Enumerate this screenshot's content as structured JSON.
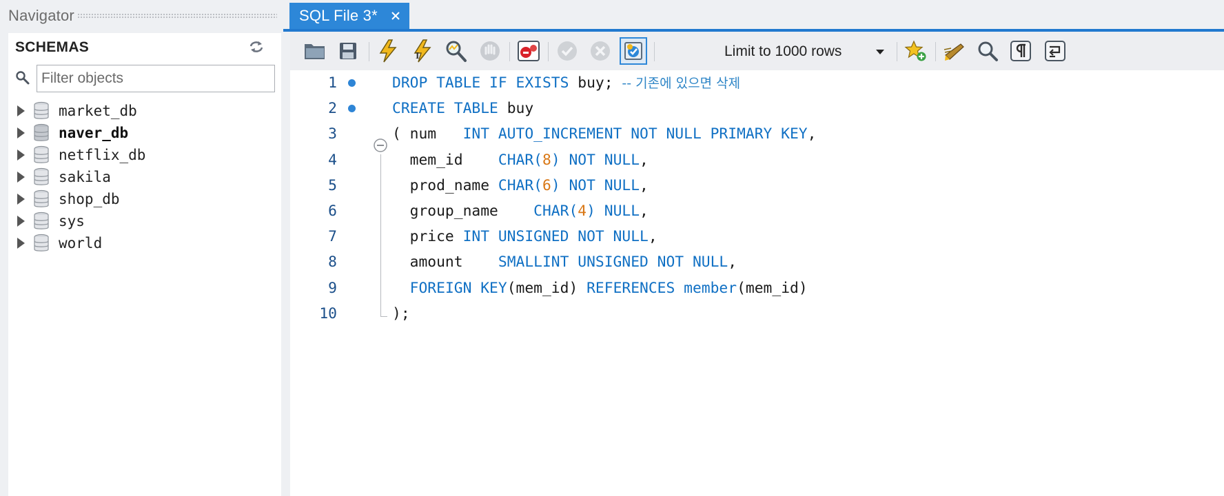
{
  "navigator": {
    "title": "Navigator",
    "schemas_label": "SCHEMAS",
    "filter_placeholder": "Filter objects",
    "schemas": [
      {
        "name": "market_db",
        "active": false
      },
      {
        "name": "naver_db",
        "active": true
      },
      {
        "name": "netflix_db",
        "active": false
      },
      {
        "name": "sakila",
        "active": false
      },
      {
        "name": "shop_db",
        "active": false
      },
      {
        "name": "sys",
        "active": false
      },
      {
        "name": "world",
        "active": false
      }
    ]
  },
  "editor": {
    "tab_label": "SQL File 3*",
    "toolbar": {
      "buttons": [
        "open-file-icon",
        "save-icon",
        "execute-icon",
        "execute-current-icon",
        "explain-icon",
        "stop-icon",
        "toggle-error-icon",
        "commit-icon",
        "rollback-icon",
        "autocommit-icon",
        "bookmark-icon",
        "beautify-icon",
        "find-icon",
        "invisible-chars-icon",
        "word-wrap-icon"
      ],
      "limit_value": "Limit to 1000 rows"
    },
    "code_lines": [
      {
        "n": "1",
        "dot": true,
        "html": "<span class=\"kw\">DROP TABLE IF EXISTS</span> buy; <span class=\"cm\">-- 기존에 있으면 삭제</span>"
      },
      {
        "n": "2",
        "dot": true,
        "html": "<span class=\"kw\">CREATE TABLE</span> buy"
      },
      {
        "n": "3",
        "dot": false,
        "html": "( num   <span class=\"kw\">INT AUTO_INCREMENT NOT NULL PRIMARY KEY</span>,"
      },
      {
        "n": "4",
        "dot": false,
        "html": "  mem_id    <span class=\"kw\">CHAR(</span><span class=\"num\">8</span><span class=\"kw\">)</span> <span class=\"kw\">NOT NULL</span>,"
      },
      {
        "n": "5",
        "dot": false,
        "html": "  prod_name <span class=\"kw\">CHAR(</span><span class=\"num\">6</span><span class=\"kw\">)</span> <span class=\"kw\">NOT NULL</span>,"
      },
      {
        "n": "6",
        "dot": false,
        "html": "  group_name    <span class=\"kw\">CHAR(</span><span class=\"num\">4</span><span class=\"kw\">)</span> <span class=\"kw\">NULL</span>,"
      },
      {
        "n": "7",
        "dot": false,
        "html": "  price <span class=\"kw\">INT UNSIGNED NOT NULL</span>,"
      },
      {
        "n": "8",
        "dot": false,
        "html": "  amount    <span class=\"kw\">SMALLINT UNSIGNED NOT NULL</span>,"
      },
      {
        "n": "9",
        "dot": false,
        "html": "  <span class=\"kw\">FOREIGN KEY</span>(mem_id) <span class=\"kw\">REFERENCES member</span>(mem_id)"
      },
      {
        "n": "10",
        "dot": false,
        "html": ");"
      }
    ]
  },
  "colors": {
    "accent": "#2179cf",
    "tab_bg": "#2d87d8",
    "keyword": "#1070c4",
    "number": "#d97715"
  }
}
